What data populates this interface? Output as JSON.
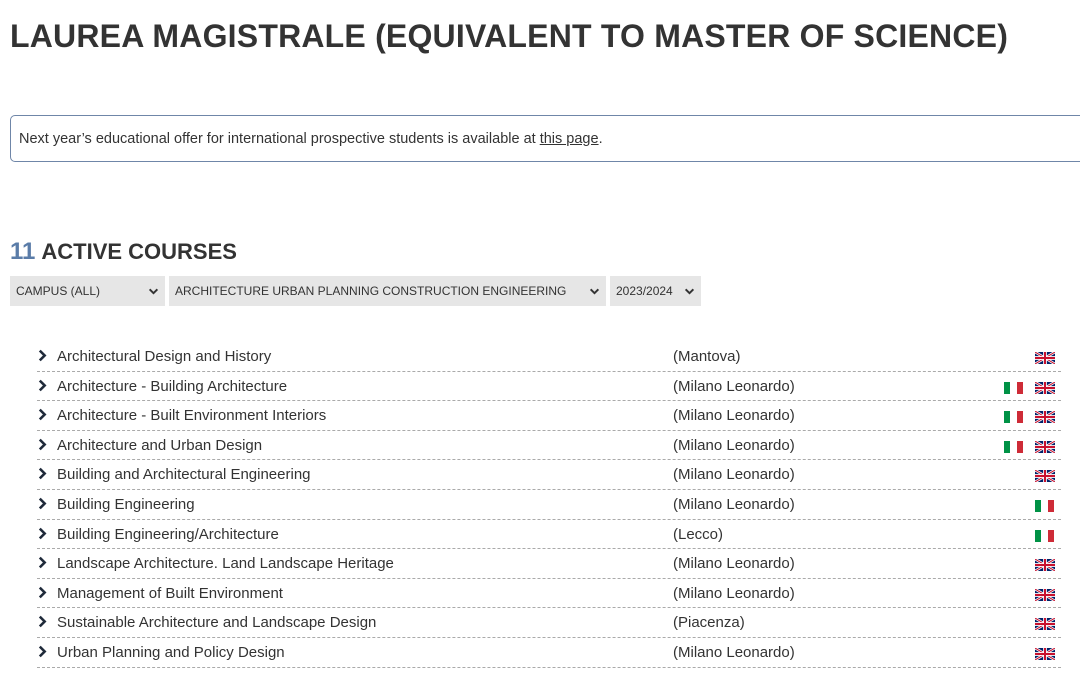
{
  "page": {
    "title": "LAUREA MAGISTRALE (EQUIVALENT TO MASTER OF SCIENCE)"
  },
  "notice": {
    "text_before": "Next year’s educational offer for international prospective students is available at ",
    "link_label": "this page",
    "text_after": "."
  },
  "courses_header": {
    "count": "11",
    "label": "ACTIVE COURSES"
  },
  "filters": {
    "campus": "CAMPUS (ALL)",
    "area": "ARCHITECTURE URBAN PLANNING CONSTRUCTION ENGINEERING",
    "year": "2023/2024"
  },
  "flag_icons": {
    "italian": "italian-flag-icon",
    "english": "uk-flag-icon"
  },
  "colors": {
    "heading": "#333333",
    "count_accent": "#5a7ca8",
    "notice_border": "#6f86a8",
    "filter_background": "#e6e6e6",
    "italy_green": "#009246",
    "italy_red": "#ce2b37",
    "uk_blue": "#012169",
    "uk_red": "#c8102e"
  },
  "courses": [
    {
      "name": "Architectural Design and History",
      "campus": "(Mantova)",
      "italian": false,
      "english": true
    },
    {
      "name": "Architecture - Building Architecture",
      "campus": "(Milano Leonardo)",
      "italian": true,
      "english": true
    },
    {
      "name": "Architecture - Built Environment Interiors",
      "campus": "(Milano Leonardo)",
      "italian": true,
      "english": true
    },
    {
      "name": "Architecture and Urban Design",
      "campus": "(Milano Leonardo)",
      "italian": true,
      "english": true
    },
    {
      "name": "Building and Architectural Engineering",
      "campus": "(Milano Leonardo)",
      "italian": false,
      "english": true
    },
    {
      "name": "Building Engineering",
      "campus": "(Milano Leonardo)",
      "italian": true,
      "english": false
    },
    {
      "name": "Building Engineering/Architecture",
      "campus": "(Lecco)",
      "italian": true,
      "english": false
    },
    {
      "name": "Landscape Architecture. Land Landscape Heritage",
      "campus": "(Milano Leonardo)",
      "italian": false,
      "english": true
    },
    {
      "name": "Management of Built Environment",
      "campus": "(Milano Leonardo)",
      "italian": false,
      "english": true
    },
    {
      "name": "Sustainable Architecture and Landscape Design",
      "campus": "(Piacenza)",
      "italian": false,
      "english": true
    },
    {
      "name": "Urban Planning and Policy Design",
      "campus": "(Milano Leonardo)",
      "italian": false,
      "english": true
    }
  ]
}
